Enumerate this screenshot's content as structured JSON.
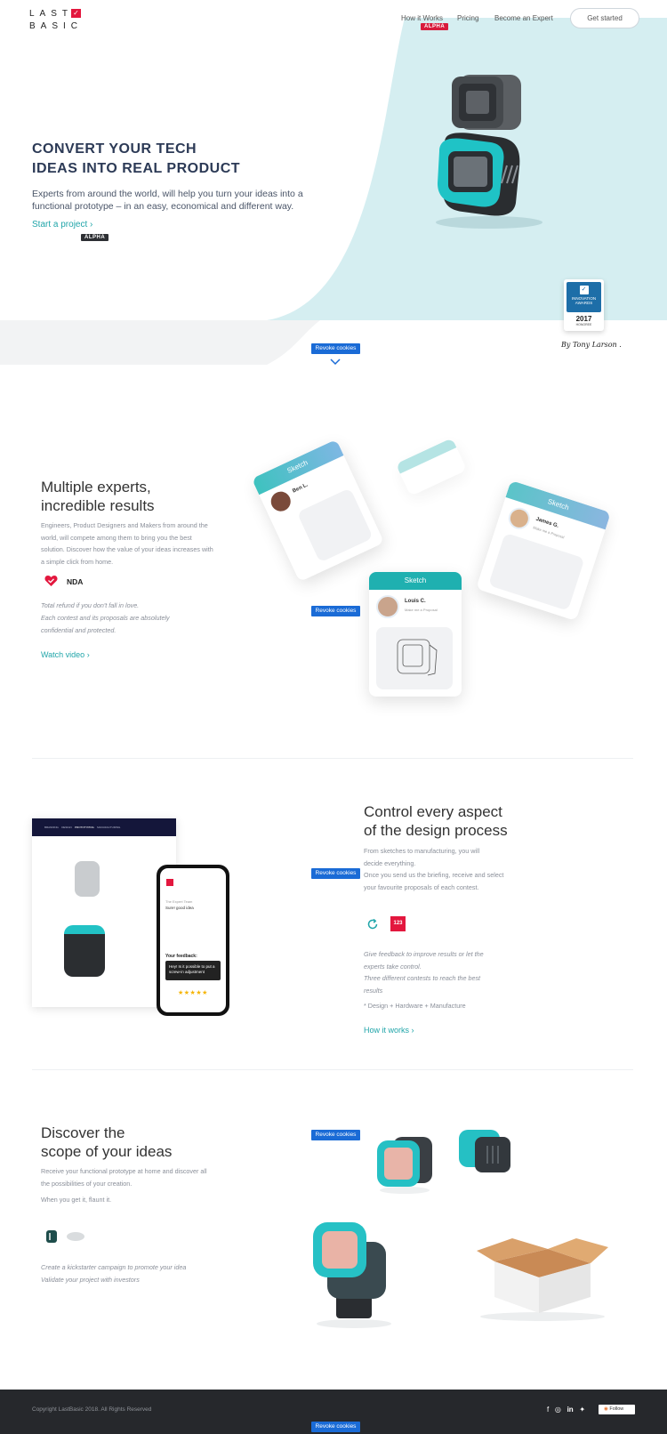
{
  "header": {
    "logo_line1": "LAST",
    "logo_line2": "BASIC",
    "logo_check": "✓",
    "nav": {
      "how_it_works": "How it Works",
      "alpha_badge": "ALPHA",
      "pricing": "Pricing",
      "become_expert": "Become an Expert"
    },
    "cta": "Get started"
  },
  "hero": {
    "title_line1": "CONVERT YOUR TECH",
    "title_line2": "IDEAS INTO REAL PRODUCT",
    "description": "Experts from around the world, will help you turn your ideas into a functional prototype – in an easy, economical and different way.",
    "start_link": "Start a project ›",
    "alpha_badge": "ALPHA",
    "award": {
      "label_line1": "INNOVATION",
      "label_line2": "AWARDS",
      "year": "2017",
      "honoree": "HONOREE"
    },
    "signature": "By Tony Larson ."
  },
  "revoke_cookies": "Revoke cookies",
  "section_experts": {
    "title_line1": "Multiple experts,",
    "title_line2": "incredible results",
    "description": "Engineers, Product Designers and Makers from around the world, will compete among them to bring you the best solution. Discover how the value of your ideas increases with a simple click from home.",
    "nda_label": "NDA",
    "italic_line1": "Total refund if you don't fall in love.",
    "italic_line2": "Each contest and its proposals are absolutely confidential and protected.",
    "watch_link": "Watch video ›",
    "cards": [
      {
        "header": "Sketch",
        "name": "Ben L.",
        "role": ""
      },
      {
        "header": "Sketch",
        "name": "Louis C.",
        "role": "Make me a Proposal"
      },
      {
        "header": "Sketch",
        "name": "James G.",
        "role": "Make me a Proposal"
      }
    ],
    "colors": {
      "brand_red": "#e3173e",
      "teal": "#20a5a9"
    }
  },
  "section_control": {
    "title_line1": "Control every aspect",
    "title_line2": "of the design process",
    "description_line1": "From sketches to manufacturing, you will decide everything.",
    "description_line2": "Once you send us the briefing, receive and select your favourite proposals of each contest.",
    "badge_123": "123",
    "italic_line1": "Give feedback to improve results or let the experts take control.",
    "italic_line2": "Three different contests to reach the best results",
    "plain_line": "* Design + Hardware + Manufacture",
    "how_link": "How it works ›",
    "mock": {
      "tabs": [
        "BRANDING",
        "DESIGN",
        "PROTOTYPING",
        "MANUFACTURING"
      ],
      "phone_expert": "The Expert Team",
      "phone_comment": "Sure! good idea",
      "phone_feedback_label": "Your feedback:",
      "phone_feedback": "Hey! Is it possible to put a screw-in adjustment",
      "stars": "★★★★★"
    }
  },
  "section_discover": {
    "title_line1": "Discover the",
    "title_line2": "scope of your ideas",
    "description": "Receive your functional prototype at home and discover all the possibilities of your creation.",
    "flaunt": "When you get it, flaunt it.",
    "italic_line1": "Create a kickstarter campaign to promote your idea",
    "italic_line2": "Validate your project with investors"
  },
  "footer": {
    "copyright": "Copyright LastBasic 2018. All Rights Reserved",
    "follow": "Follow"
  }
}
